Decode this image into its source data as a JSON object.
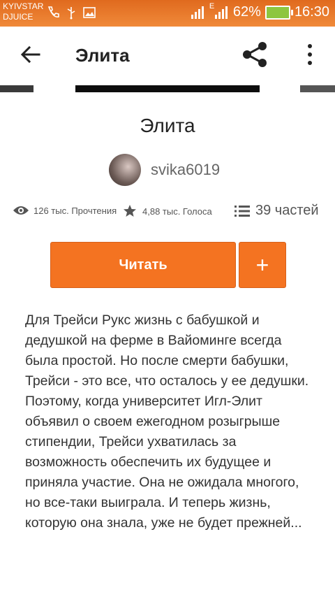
{
  "status_bar": {
    "carrier_line1": "KYIVSTAR",
    "carrier_line2": "DJUICE",
    "battery": "62%",
    "time": "16:30",
    "network_label": "E"
  },
  "app_bar": {
    "title": "Элита",
    "icons": [
      "back-arrow-icon",
      "share-icon",
      "more-vert-icon"
    ]
  },
  "story": {
    "title": "Элита",
    "author": "svika6019",
    "reads": "126 тыс. Прочтения",
    "votes": "4,88 тыс. Голоса",
    "parts": "39 частей",
    "read_button": "Читать",
    "add_button": "+",
    "description": "Для Трейси Рукс жизнь с бабушкой и дедушкой на ферме в Вайоминге всегда была простой. Но после смерти бабушки, Трейси - это все, что осталось у ее дедушки. Поэтому, когда университет Игл-Элит объявил о своем ежегодном розыгрыше стипендии, Трейси ухватилась за возможность обеспечить их будущее и приняла участие. Она не ожидала многого, но все-таки выиграла. И теперь жизнь, которую она знала, уже не будет прежней..."
  },
  "colors": {
    "accent": "#f47321",
    "status_bar": "#e9772a"
  }
}
